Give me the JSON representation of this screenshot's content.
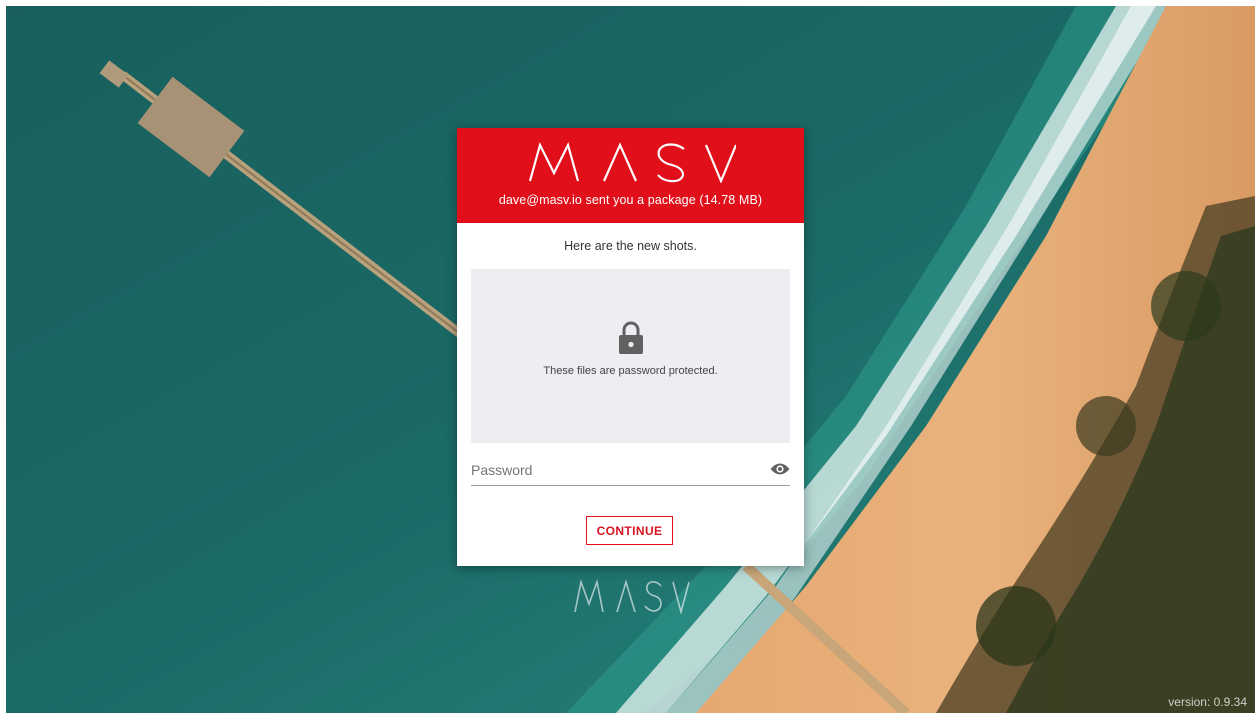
{
  "brand": {
    "logo_text": "MASV",
    "header_color": "#e10f1a",
    "accent_color": "#d81420"
  },
  "package": {
    "sender_text": "dave@masv.io sent you a package (14.78 MB)",
    "message": "Here are the new shots."
  },
  "protection": {
    "icon": "lock-icon",
    "text": "These files are password protected."
  },
  "password": {
    "placeholder": "Password",
    "value": "",
    "toggle_icon": "eye-icon"
  },
  "actions": {
    "continue_label": "CONTINUE"
  },
  "footer": {
    "version_text": "version: 0.9.34"
  }
}
